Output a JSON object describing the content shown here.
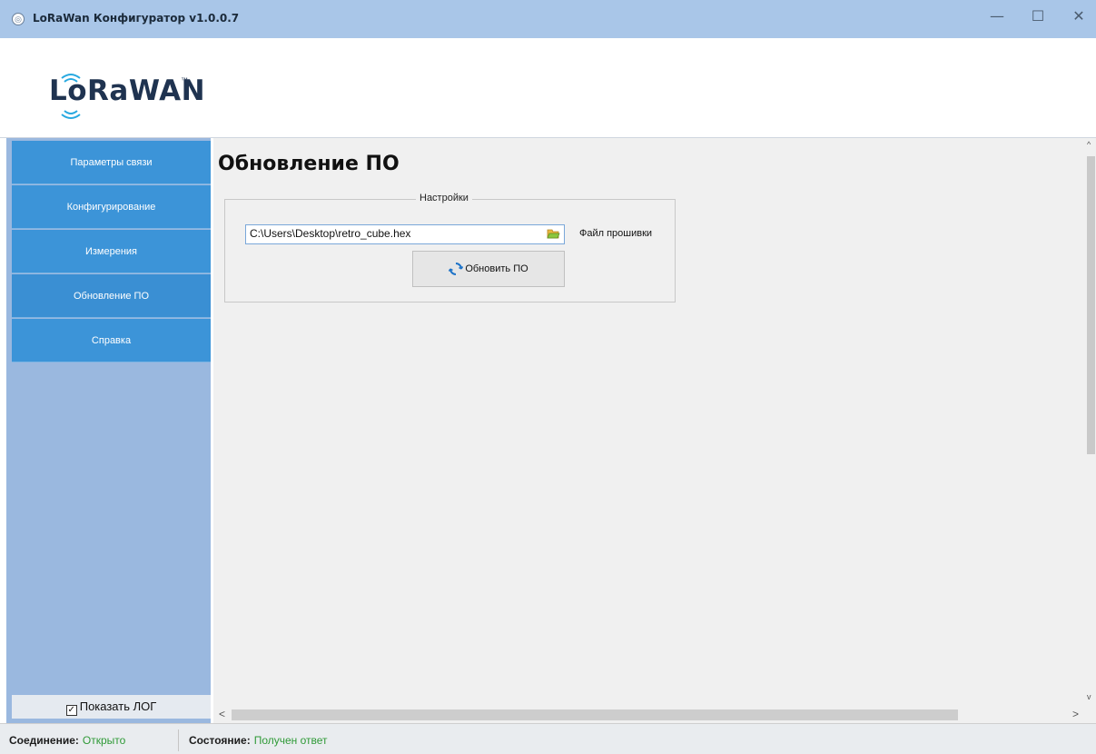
{
  "window": {
    "title": "LoRaWan Конфигуратор v1.0.0.7",
    "controls": {
      "minimize": "—",
      "maximize": "☐",
      "close": "✕"
    }
  },
  "logo": {
    "text": "LoRaWAN",
    "tm": "™"
  },
  "sidebar": {
    "items": [
      {
        "label": "Параметры связи"
      },
      {
        "label": "Конфигурирование"
      },
      {
        "label": "Измерения"
      },
      {
        "label": "Обновление ПО"
      },
      {
        "label": "Справка"
      }
    ],
    "show_log": {
      "label": "Показать ЛОГ",
      "checked": true,
      "check_glyph": "✓"
    }
  },
  "main": {
    "title": "Обновление ПО",
    "group": {
      "label": "Настройки",
      "path_value": "C:\\Users\\Desktop\\retro_cube.hex",
      "file_label": "Файл прошивки",
      "update_button": "Обновить ПО"
    }
  },
  "scroll": {
    "up": "^",
    "down": "v",
    "left": "<",
    "right": ">"
  },
  "status": {
    "connection_key": "Соединение:",
    "connection_value": "Открыто",
    "state_key": "Состояние:",
    "state_value": "Получен ответ"
  },
  "colors": {
    "titlebar": "#a9c6e8",
    "sidebar_bg": "#9ab8df",
    "nav_item": "#3c94d8",
    "status_ok": "#2f9a37"
  },
  "icons": {
    "folder": "folder-open-icon",
    "refresh": "refresh-icon",
    "app": "app-icon"
  }
}
